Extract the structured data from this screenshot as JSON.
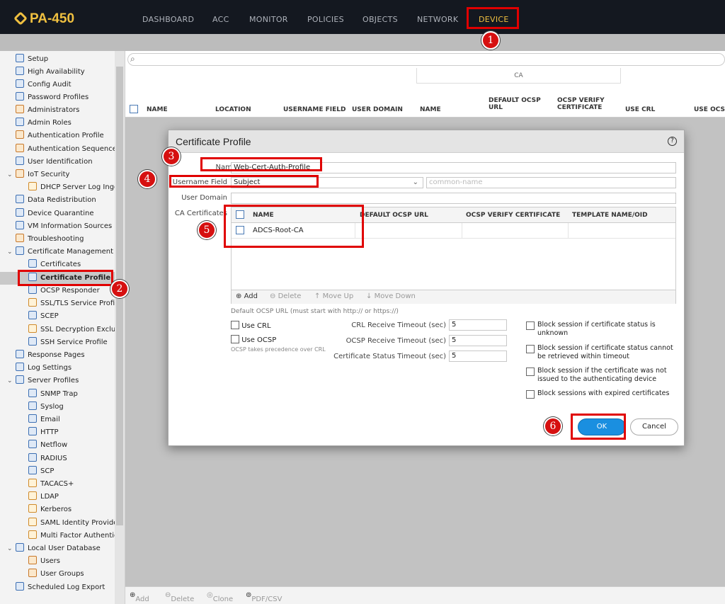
{
  "app": {
    "title": "PA-450"
  },
  "nav": [
    {
      "label": "DASHBOARD"
    },
    {
      "label": "ACC"
    },
    {
      "label": "MONITOR"
    },
    {
      "label": "POLICIES"
    },
    {
      "label": "OBJECTS"
    },
    {
      "label": "NETWORK"
    },
    {
      "label": "DEVICE"
    }
  ],
  "sidebar": {
    "items": [
      {
        "label": "Setup"
      },
      {
        "label": "High Availability"
      },
      {
        "label": "Config Audit"
      },
      {
        "label": "Password Profiles"
      },
      {
        "label": "Administrators"
      },
      {
        "label": "Admin Roles"
      },
      {
        "label": "Authentication Profile"
      },
      {
        "label": "Authentication Sequence"
      },
      {
        "label": "User Identification"
      },
      {
        "label": "IoT Security"
      },
      {
        "label": "DHCP Server Log Ingestion"
      },
      {
        "label": "Data Redistribution"
      },
      {
        "label": "Device Quarantine"
      },
      {
        "label": "VM Information Sources"
      },
      {
        "label": "Troubleshooting"
      },
      {
        "label": "Certificate Management"
      },
      {
        "label": "Certificates"
      },
      {
        "label": "Certificate Profile"
      },
      {
        "label": "OCSP Responder"
      },
      {
        "label": "SSL/TLS Service Profile"
      },
      {
        "label": "SCEP"
      },
      {
        "label": "SSL Decryption Exclusion"
      },
      {
        "label": "SSH Service Profile"
      },
      {
        "label": "Response Pages"
      },
      {
        "label": "Log Settings"
      },
      {
        "label": "Server Profiles"
      },
      {
        "label": "SNMP Trap"
      },
      {
        "label": "Syslog"
      },
      {
        "label": "Email"
      },
      {
        "label": "HTTP"
      },
      {
        "label": "Netflow"
      },
      {
        "label": "RADIUS"
      },
      {
        "label": "SCP"
      },
      {
        "label": "TACACS+"
      },
      {
        "label": "LDAP"
      },
      {
        "label": "Kerberos"
      },
      {
        "label": "SAML Identity Provider"
      },
      {
        "label": "Multi Factor Authentication"
      },
      {
        "label": "Local User Database"
      },
      {
        "label": "Users"
      },
      {
        "label": "User Groups"
      },
      {
        "label": "Scheduled Log Export"
      }
    ]
  },
  "table": {
    "group_header": "CA",
    "columns": [
      "NAME",
      "LOCATION",
      "USERNAME FIELD",
      "USER DOMAIN",
      "NAME",
      "DEFAULT OCSP URL",
      "OCSP VERIFY CERTIFICATE",
      "USE CRL",
      "USE OCSP"
    ]
  },
  "footer": {
    "add": "Add",
    "delete": "Delete",
    "clone": "Clone",
    "pdf": "PDF/CSV"
  },
  "dialog": {
    "title": "Certificate Profile",
    "name_label": "Name",
    "name_value": "Web-Cert-Auth-Profile",
    "username_field_label": "Username Field",
    "username_field_value": "Subject",
    "username_placeholder": "common-name",
    "user_domain_label": "User Domain",
    "ca_certificates_label": "CA Certificates",
    "ca_table": {
      "columns": [
        "NAME",
        "DEFAULT OCSP URL",
        "OCSP VERIFY CERTIFICATE",
        "TEMPLATE NAME/OID"
      ],
      "rows": [
        {
          "name": "ADCS-Root-CA"
        }
      ]
    },
    "ca_toolbar": {
      "add": "Add",
      "delete": "Delete",
      "move_up": "Move Up",
      "move_down": "Move Down"
    },
    "ocsp_hint": "Default OCSP URL (must start with http:// or https://)",
    "use_crl": "Use CRL",
    "use_ocsp": "Use OCSP",
    "ocsp_precedence": "OCSP takes precedence over CRL",
    "crl_timeout_label": "CRL Receive Timeout (sec)",
    "crl_timeout_value": "5",
    "ocsp_timeout_label": "OCSP Receive Timeout (sec)",
    "ocsp_timeout_value": "5",
    "status_timeout_label": "Certificate Status Timeout (sec)",
    "status_timeout_value": "5",
    "block_unknown": "Block session if certificate status is unknown",
    "block_timeout": "Block session if certificate status cannot be retrieved within timeout",
    "block_not_issued": "Block session if the certificate was not issued to the authenticating device",
    "block_expired": "Block sessions with expired certificates",
    "ok": "OK",
    "cancel": "Cancel"
  },
  "annotations": [
    "1",
    "2",
    "3",
    "4",
    "5",
    "6"
  ]
}
